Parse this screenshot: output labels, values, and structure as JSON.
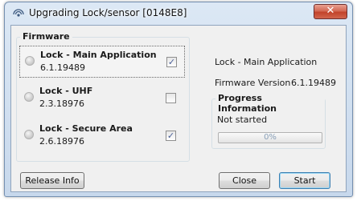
{
  "window": {
    "title": "Upgrading Lock/sensor [0148E8]",
    "close_label": "✕"
  },
  "firmware": {
    "legend": "Firmware",
    "items": [
      {
        "name": "Lock - Main Application",
        "version": "6.1.19489",
        "checked": true,
        "checkmark": "✓",
        "selected": true
      },
      {
        "name": "Lock - UHF",
        "version": "2.3.18976",
        "checked": false,
        "checkmark": "",
        "selected": false
      },
      {
        "name": "Lock - Secure Area",
        "version": "2.6.18976",
        "checked": true,
        "checkmark": "✓",
        "selected": false
      }
    ]
  },
  "details": {
    "name": "Lock - Main Application",
    "firmware_version_label": "Firmware Version",
    "firmware_version": "6.1.19489"
  },
  "progress": {
    "legend": "Progress Information",
    "status": "Not started",
    "percent": 0,
    "percent_text": "0%"
  },
  "buttons": {
    "release_info": "Release Info",
    "close": "Close",
    "start": "Start"
  },
  "colors": {
    "title_bar": "#c7d8ec",
    "close_button": "#c2432b",
    "client_bg": "#f0f0f0",
    "progress_text": "#8aa0b8"
  }
}
